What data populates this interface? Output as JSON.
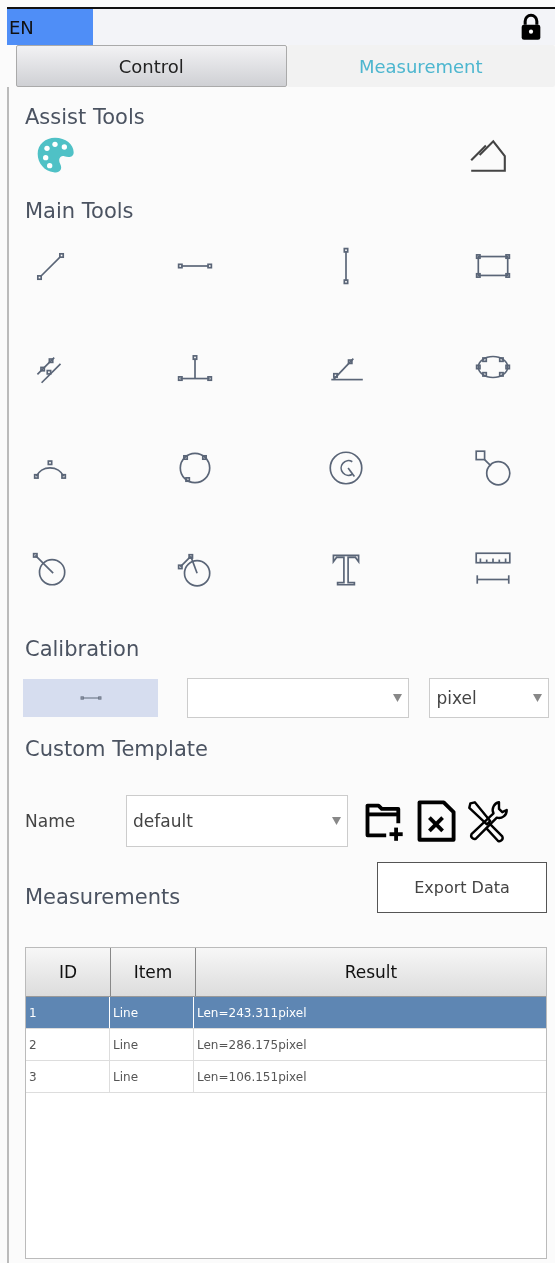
{
  "top_bar": {
    "language": "EN",
    "locked": true
  },
  "tabs": [
    {
      "label": "Control",
      "selected": false
    },
    {
      "label": "Measurement",
      "selected": true
    }
  ],
  "assist_tools": {
    "title": "Assist Tools"
  },
  "main_tools": {
    "title": "Main Tools"
  },
  "calibration": {
    "title": "Calibration",
    "unit": "pixel"
  },
  "custom_template": {
    "title": "Custom Template",
    "name_label": "Name",
    "name_value": "default"
  },
  "measurements": {
    "title": "Measurements",
    "export_button": "Export Data",
    "columns": [
      "ID",
      "Item",
      "Result"
    ],
    "rows": [
      {
        "id": "1",
        "item": "Line",
        "result": "Len=243.311pixel",
        "selected": true
      },
      {
        "id": "2",
        "item": "Line",
        "result": "Len=286.175pixel",
        "selected": false
      },
      {
        "id": "3",
        "item": "Line",
        "result": "Len=106.151pixel",
        "selected": false
      }
    ]
  }
}
